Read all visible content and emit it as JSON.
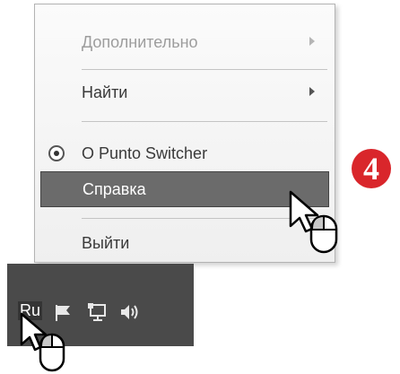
{
  "menu": {
    "items": [
      {
        "label": "Дополнительно",
        "state": "disabled",
        "submenu": true
      },
      {
        "label": "Найти",
        "state": "normal",
        "submenu": true
      },
      {
        "label": "О Punto Switcher",
        "state": "normal",
        "submenu": false,
        "icon": "radio-icon"
      },
      {
        "label": "Справка",
        "state": "highlighted",
        "submenu": false
      },
      {
        "label": "Выйти",
        "state": "normal",
        "submenu": false
      }
    ]
  },
  "step_badge": "4",
  "tray": {
    "language_label": "Ru",
    "icons": [
      "language-indicator",
      "flag-icon",
      "network-icon",
      "speaker-icon"
    ]
  },
  "colors": {
    "menu_highlight": "#6b6b6b",
    "taskbar": "#4a4a4a",
    "badge": "#d9262b"
  }
}
